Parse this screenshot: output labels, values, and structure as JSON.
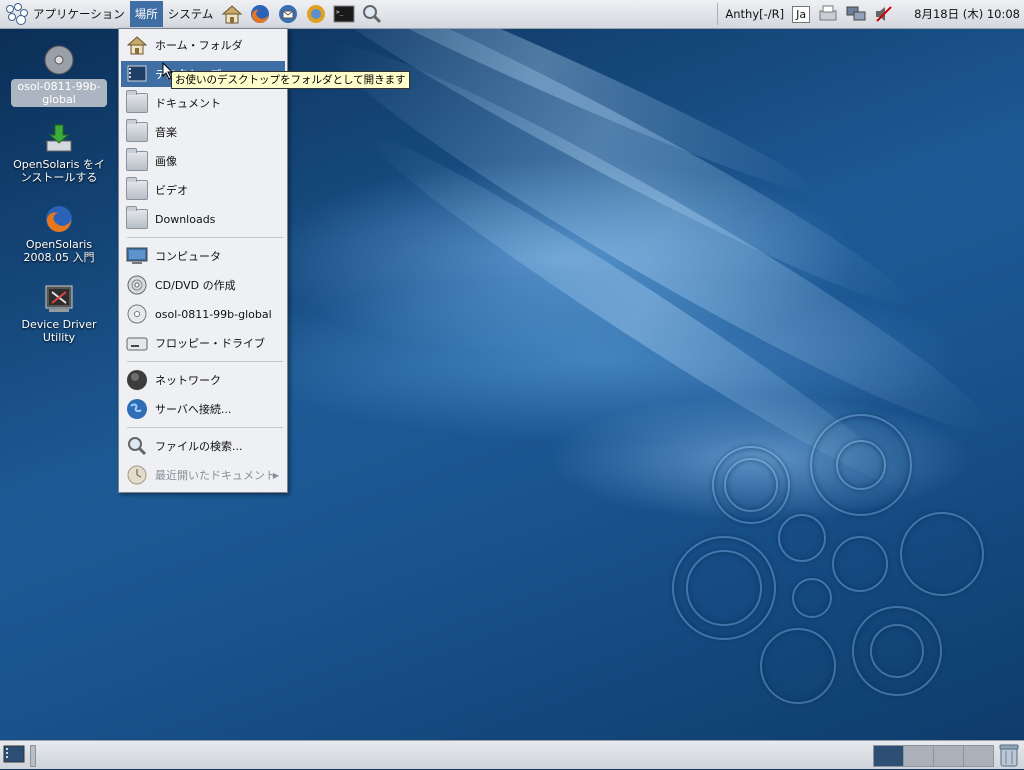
{
  "top_panel": {
    "menus": {
      "applications": "アプリケーション",
      "places": "場所",
      "system": "システム"
    },
    "launchers": [
      "home-icon",
      "firefox-icon",
      "thunderbird-icon",
      "update-icon",
      "terminal-icon",
      "search-icon"
    ],
    "input_method": "Anthy[-/R]",
    "keyboard_lang": "Ja",
    "clock": "8月18日 (木) 10:08"
  },
  "desktop_icons": [
    {
      "label": "osol-0811-99b-global",
      "icon": "cdrom-icon",
      "selected": true
    },
    {
      "label": "OpenSolaris をインストールする",
      "icon": "install-icon"
    },
    {
      "label": "OpenSolaris 2008.05 入門",
      "icon": "firefox-icon"
    },
    {
      "label": "Device Driver Utility",
      "icon": "device-driver-icon"
    }
  ],
  "places_menu": {
    "items": [
      {
        "label": "ホーム・フォルダ",
        "icon": "home-folder-icon"
      },
      {
        "label": "デスクトップ",
        "icon": "desktop-folder-icon",
        "highlighted": true
      },
      {
        "label": "ドキュメント",
        "icon": "folder-icon"
      },
      {
        "label": "音楽",
        "icon": "folder-icon"
      },
      {
        "label": "画像",
        "icon": "folder-icon"
      },
      {
        "label": "ビデオ",
        "icon": "folder-icon"
      },
      {
        "label": "Downloads",
        "icon": "folder-icon"
      },
      {
        "label": "コンピュータ",
        "icon": "computer-icon"
      },
      {
        "label": "CD/DVD の作成",
        "icon": "cd-burner-icon"
      },
      {
        "label": "osol-0811-99b-global",
        "icon": "cdrom-icon"
      },
      {
        "label": "フロッピー・ドライブ",
        "icon": "floppy-icon"
      },
      {
        "label": "ネットワーク",
        "icon": "network-icon"
      },
      {
        "label": "サーバへ接続...",
        "icon": "globe-icon"
      },
      {
        "label": "ファイルの検索...",
        "icon": "search-icon"
      },
      {
        "label": "最近開いたドキュメント",
        "icon": "recent-icon",
        "disabled": true
      }
    ]
  },
  "tooltip": "お使いのデスクトップをフォルダとして開きます",
  "bottom_panel": {
    "workspaces": 4,
    "active_workspace": 1
  },
  "colors": {
    "highlight": "#3e6ea3",
    "panel": "#e0e3e7",
    "tooltip_bg": "#ffffcc"
  }
}
